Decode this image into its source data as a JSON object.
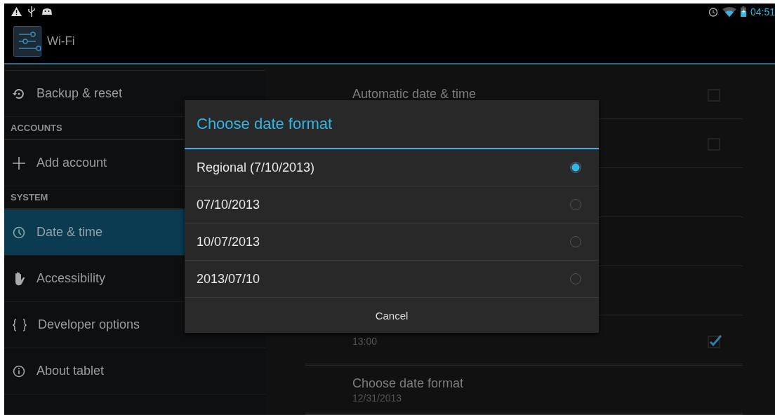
{
  "status_bar": {
    "time": "04:51"
  },
  "action_bar": {
    "title": "Wi-Fi"
  },
  "sidebar": {
    "items": [
      {
        "kind": "item",
        "label": "Backup & reset",
        "selected": false
      },
      {
        "kind": "header",
        "label": "ACCOUNTS"
      },
      {
        "kind": "item",
        "label": "Add account",
        "selected": false
      },
      {
        "kind": "header",
        "label": "SYSTEM"
      },
      {
        "kind": "item",
        "label": "Date & time",
        "selected": true
      },
      {
        "kind": "item",
        "label": "Accessibility",
        "selected": false
      },
      {
        "kind": "item",
        "label": "Developer options",
        "selected": false
      },
      {
        "kind": "item",
        "label": "About tablet",
        "selected": false
      }
    ]
  },
  "settings": [
    {
      "title": "Automatic date & time",
      "checked": false
    },
    {
      "checked": false
    },
    {
      "summary": "13:00",
      "checked": true
    },
    {
      "title": "Choose date format",
      "summary": "12/31/2013"
    }
  ],
  "dialog": {
    "title": "Choose date format",
    "options": [
      {
        "label": "Regional (7/10/2013)",
        "selected": true
      },
      {
        "label": "07/10/2013",
        "selected": false
      },
      {
        "label": "10/07/2013",
        "selected": false
      },
      {
        "label": "2013/07/10",
        "selected": false
      }
    ],
    "button": "Cancel"
  }
}
